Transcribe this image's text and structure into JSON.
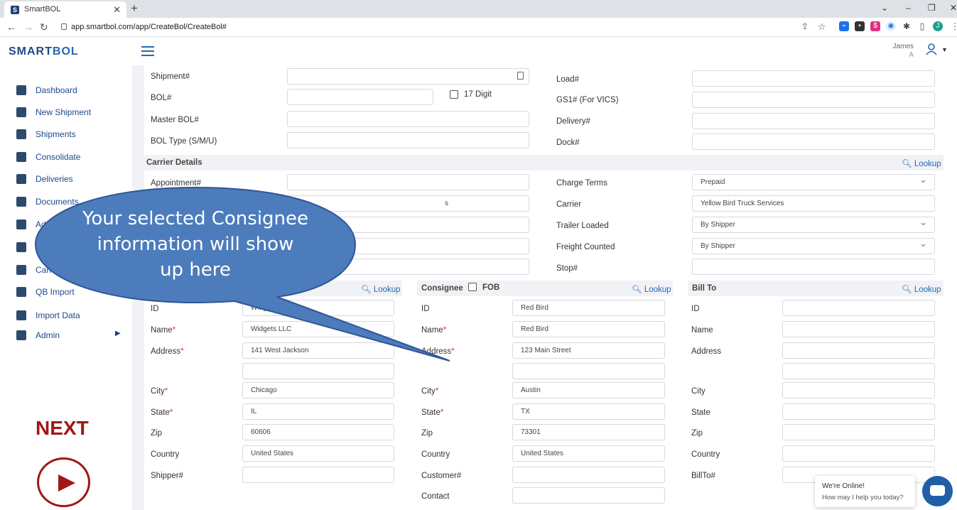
{
  "browser": {
    "tab_title": "SmartBOL",
    "favicon": "S",
    "url": "app.smartbol.com/app/CreateBol/CreateBol#",
    "profile_initial": "J"
  },
  "header": {
    "logo_prefix": "SMART",
    "logo_suffix": "BOL",
    "user_first": "James",
    "user_second": "A"
  },
  "sidebar": {
    "items": [
      {
        "label": "Dashboard",
        "icon": "dashboard-icon"
      },
      {
        "label": "New Shipment",
        "icon": "edit-icon"
      },
      {
        "label": "Shipments",
        "icon": "boxes-icon"
      },
      {
        "label": "Consolidate",
        "icon": "hierarchy-icon"
      },
      {
        "label": "Deliveries",
        "icon": "calendar-icon"
      },
      {
        "label": "Documents",
        "icon": "document-icon"
      },
      {
        "label": "Ad",
        "icon": "contact-icon"
      },
      {
        "label": "",
        "icon": "package-icon"
      },
      {
        "label": "Carri",
        "icon": "truck-icon"
      },
      {
        "label": "QB Import",
        "icon": "import-icon"
      },
      {
        "label": "Import Data",
        "icon": "import-data-icon"
      },
      {
        "label": "Admin",
        "icon": "admin-icon"
      }
    ],
    "next_label": "NEXT"
  },
  "form": {
    "shipment_label": "Shipment#",
    "bol_label": "BOL#",
    "digit17_label": "17 Digit",
    "master_bol_label": "Master BOL#",
    "bol_type_label": "BOL Type (S/M/U)",
    "load_label": "Load#",
    "gs1_label": "GS1# (For VICS)",
    "delivery_label": "Delivery#",
    "dock_label": "Dock#",
    "carrier_details": "Carrier Details",
    "lookup": "Lookup",
    "appointment_label": "Appointment#",
    "partial_value": "s",
    "charge_terms_label": "Charge Terms",
    "charge_terms_value": "Prepaid",
    "carrier_label": "Carrier",
    "carrier_value": "Yellow Bird Truck Services",
    "trailer_loaded_label": "Trailer Loaded",
    "trailer_loaded_value": "By Shipper",
    "freight_counted_label": "Freight Counted",
    "freight_counted_value": "By Shipper",
    "stop_label": "Stop#"
  },
  "shipper": {
    "id_label": "ID",
    "id": "Widgets LLC",
    "name_label": "Name",
    "name": "Widgets LLC",
    "address_label": "Address",
    "address": "141 West Jackson",
    "city_label": "City",
    "city": "Chicago",
    "state_label": "State",
    "state": "IL",
    "zip_label": "Zip",
    "zip": "60606",
    "country_label": "Country",
    "country": "United States",
    "extra_label": "Shipper#"
  },
  "consignee": {
    "title": "Consignee",
    "fob_label": "FOB",
    "id_label": "ID",
    "id": "Red Bird",
    "name_label": "Name",
    "name": "Red Bird",
    "address_label": "Address",
    "address": "123 Main Street",
    "city_label": "City",
    "city": "Austin",
    "state_label": "State",
    "state": "TX",
    "zip_label": "Zip",
    "zip": "73301",
    "country_label": "Country",
    "country": "United States",
    "extra_label": "Customer#",
    "contact_label": "Contact"
  },
  "billto": {
    "title": "Bill To",
    "id_label": "ID",
    "name_label": "Name",
    "address_label": "Address",
    "city_label": "City",
    "state_label": "State",
    "zip_label": "Zip",
    "country_label": "Country",
    "extra_label": "BillTo#"
  },
  "chat": {
    "title": "We're Online!",
    "subtitle": "How may I help you today?"
  },
  "callout": {
    "line1": "Your selected Consignee",
    "line2": "information will show",
    "line3": "up here"
  }
}
